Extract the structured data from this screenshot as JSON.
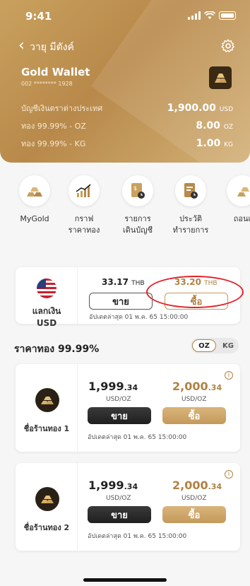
{
  "status": {
    "time": "9:41"
  },
  "nav": {
    "title": "วายุ มีตังค์"
  },
  "wallet": {
    "title": "Gold Wallet",
    "number": "002 ******** 1928"
  },
  "balances": [
    {
      "label": "บัญชีเงินตราต่างประเทศ",
      "value": "1,900.00",
      "unit": "USD"
    },
    {
      "label": "ทอง 99.99% - OZ",
      "value": "8.00",
      "unit": "OZ"
    },
    {
      "label": "ทอง 99.99% - KG",
      "value": "1.00",
      "unit": "KG"
    }
  ],
  "menu": [
    {
      "label": "MyGold",
      "icon": "gold-bars-icon"
    },
    {
      "label": "กราฟ\nราคาทอง",
      "icon": "chart-icon"
    },
    {
      "label": "รายการ\nเดินบัญชี",
      "icon": "statement-icon"
    },
    {
      "label": "ประวัติ\nทำรายการ",
      "icon": "history-icon"
    },
    {
      "label": "ถอนเ",
      "icon": "withdraw-icon"
    }
  ],
  "exchange": {
    "currency_label": "แลกเงิน\nUSD",
    "sell_rate": "33.17",
    "buy_rate": "33.20",
    "rate_unit": "THB",
    "sell_label": "ขาย",
    "buy_label": "ซื้อ",
    "updated": "อัปเดตล่าสุด 01 พ.ค. 65 15:00:00"
  },
  "gold_section": {
    "title": "ราคาทอง 99.99%",
    "toggle_on": "OZ",
    "toggle_off": "KG"
  },
  "stores": [
    {
      "name": "ชื่อร้านทอง 1",
      "sell_main": "1,999",
      "sell_dec": ".34",
      "buy_main": "2,000",
      "buy_dec": ".34",
      "unit": "USD/OZ",
      "sell_label": "ขาย",
      "buy_label": "ซื้อ",
      "updated": "อัปเดตล่าสุด 01 พ.ค. 65 15:00:00"
    },
    {
      "name": "ชื่อร้านทอง 2",
      "sell_main": "1,999",
      "sell_dec": ".34",
      "buy_main": "2,000",
      "buy_dec": ".34",
      "unit": "USD/OZ",
      "sell_label": "ขาย",
      "buy_label": "ซื้อ",
      "updated": "อัปเดตล่าสุด 01 พ.ค. 65 15:00:00"
    }
  ],
  "colors": {
    "gold": "#c49a5b",
    "gold_dark": "#b08243",
    "dark_button": "#2a2a2a",
    "highlight": "#e4202a"
  }
}
